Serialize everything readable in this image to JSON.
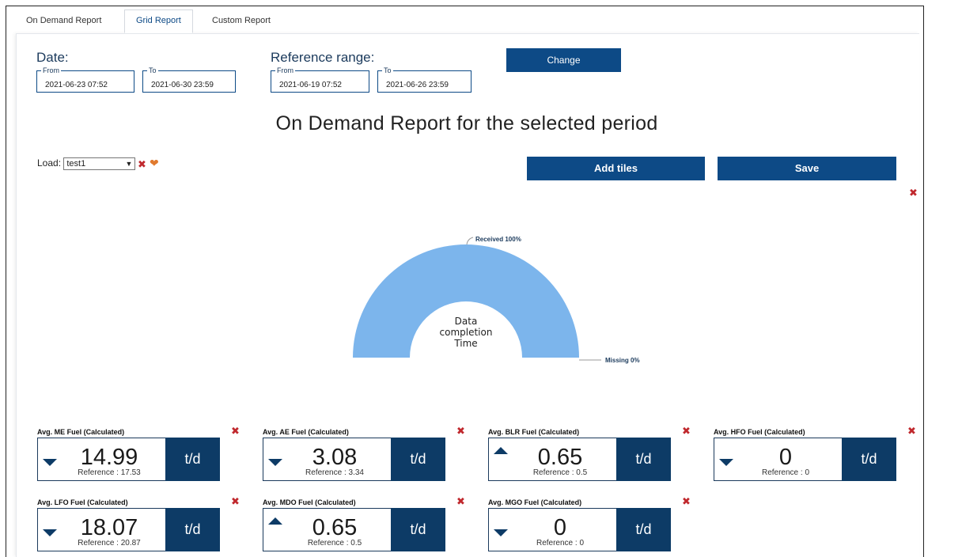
{
  "tabs": [
    {
      "label": "On Demand Report"
    },
    {
      "label": "Grid Report"
    },
    {
      "label": "Custom Report"
    }
  ],
  "date": {
    "title": "Date:",
    "from_legend": "From",
    "from_value": "2021-06-23 07:52",
    "to_legend": "To",
    "to_value": "2021-06-30 23:59"
  },
  "reference": {
    "title": "Reference range:",
    "from_legend": "From",
    "from_value": "2021-06-19 07:52",
    "to_legend": "To",
    "to_value": "2021-06-26 23:59"
  },
  "change_label": "Change",
  "page_title": "On Demand Report for the selected period",
  "load": {
    "label": "Load:",
    "selected": "test1"
  },
  "add_tiles_label": "Add tiles",
  "save_label": "Save",
  "colors": {
    "accent": "#0d4a86",
    "unit_block": "#0d3b66",
    "gauge_fill": "#7cb5ec",
    "remove": "#c0282d",
    "favorite": "#e07a2e"
  },
  "chart_data": {
    "type": "pie",
    "variant": "semi-donut",
    "center_label": [
      "Data",
      "completion",
      "Time"
    ],
    "labels": [
      "Received 100%",
      "Missing 0%"
    ],
    "slices": [
      {
        "name": "Received",
        "value": 100
      },
      {
        "name": "Missing",
        "value": 0
      }
    ]
  },
  "tiles": [
    {
      "title": "Avg. ME Fuel (Calculated)",
      "value": "14.99",
      "reference": "Reference : 17.53",
      "unit": "t/d",
      "trend": "down"
    },
    {
      "title": "Avg. AE Fuel (Calculated)",
      "value": "3.08",
      "reference": "Reference : 3.34",
      "unit": "t/d",
      "trend": "down"
    },
    {
      "title": "Avg. BLR Fuel (Calculated)",
      "value": "0.65",
      "reference": "Reference : 0.5",
      "unit": "t/d",
      "trend": "up"
    },
    {
      "title": "Avg. HFO Fuel (Calculated)",
      "value": "0",
      "reference": "Reference : 0",
      "unit": "t/d",
      "trend": "down"
    },
    {
      "title": "Avg. LFO Fuel (Calculated)",
      "value": "18.07",
      "reference": "Reference : 20.87",
      "unit": "t/d",
      "trend": "down"
    },
    {
      "title": "Avg. MDO Fuel (Calculated)",
      "value": "0.65",
      "reference": "Reference : 0.5",
      "unit": "t/d",
      "trend": "up"
    },
    {
      "title": "Avg. MGO Fuel (Calculated)",
      "value": "0",
      "reference": "Reference : 0",
      "unit": "t/d",
      "trend": "down"
    }
  ]
}
